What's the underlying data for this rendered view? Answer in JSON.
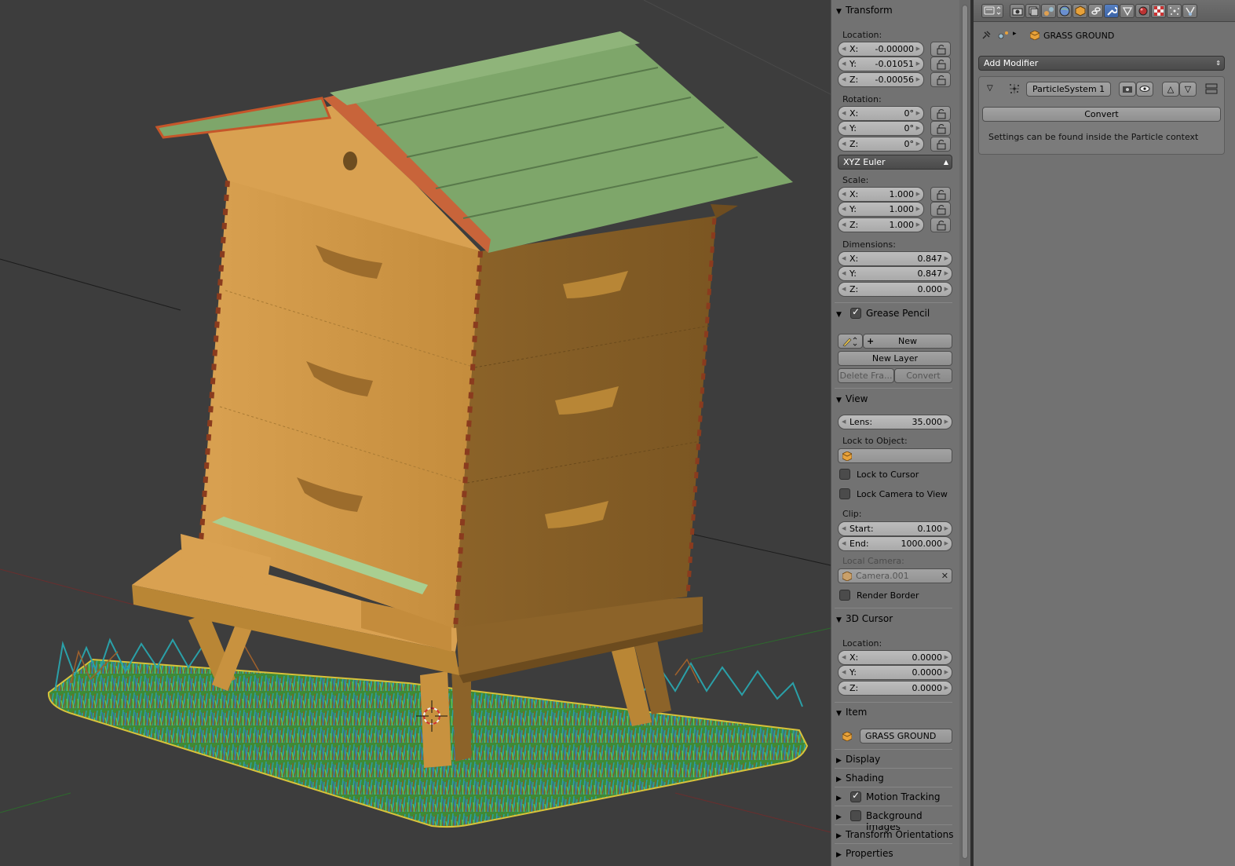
{
  "npanel": {
    "transform": {
      "title": "Transform",
      "location_label": "Location:",
      "location": [
        {
          "k": "X:",
          "v": "-0.00000"
        },
        {
          "k": "Y:",
          "v": "-0.01051"
        },
        {
          "k": "Z:",
          "v": "-0.00056"
        }
      ],
      "rotation_label": "Rotation:",
      "rotation": [
        {
          "k": "X:",
          "v": "0°"
        },
        {
          "k": "Y:",
          "v": "0°"
        },
        {
          "k": "Z:",
          "v": "0°"
        }
      ],
      "rotation_mode": "XYZ Euler",
      "scale_label": "Scale:",
      "scale": [
        {
          "k": "X:",
          "v": "1.000"
        },
        {
          "k": "Y:",
          "v": "1.000"
        },
        {
          "k": "Z:",
          "v": "1.000"
        }
      ],
      "dimensions_label": "Dimensions:",
      "dimensions": [
        {
          "k": "X:",
          "v": "0.847"
        },
        {
          "k": "Y:",
          "v": "0.847"
        },
        {
          "k": "Z:",
          "v": "0.000"
        }
      ]
    },
    "grease_pencil": {
      "title": "Grease Pencil",
      "enabled": true,
      "new_label": "New",
      "new_layer_label": "New Layer",
      "delete_frame_label": "Delete Fra...",
      "convert_label": "Convert"
    },
    "view": {
      "title": "View",
      "lens_key": "Lens:",
      "lens_value": "35.000",
      "lock_object_label": "Lock to Object:",
      "lock_cursor_label": "Lock to Cursor",
      "lock_camera_label": "Lock Camera to View",
      "clip_label": "Clip:",
      "clip_start_key": "Start:",
      "clip_start_value": "0.100",
      "clip_end_key": "End:",
      "clip_end_value": "1000.000",
      "local_camera_label": "Local Camera:",
      "local_camera_value": "Camera.001",
      "render_border_label": "Render Border"
    },
    "cursor": {
      "title": "3D Cursor",
      "location_label": "Location:",
      "location": [
        {
          "k": "X:",
          "v": "0.0000"
        },
        {
          "k": "Y:",
          "v": "0.0000"
        },
        {
          "k": "Z:",
          "v": "0.0000"
        }
      ]
    },
    "item": {
      "title": "Item",
      "name": "GRASS GROUND"
    },
    "collapsed": {
      "display": "Display",
      "shading": "Shading",
      "motion_tracking": "Motion Tracking",
      "background_images": "Background Images",
      "transform_orientations": "Transform Orientations",
      "properties": "Properties"
    }
  },
  "props": {
    "active_tab": "modifiers",
    "object_name": "GRASS GROUND",
    "add_modifier_label": "Add Modifier",
    "modifier_name": "ParticleSystem 1",
    "convert_label": "Convert",
    "info_text": "Settings can be found inside the Particle context"
  },
  "colors": {
    "panel_bg": "#727272",
    "viewport_bg": "#3d3d3d",
    "active_tab": "#5680c2",
    "hive_wood": "#c8923f",
    "roof_green": "#7ea66a"
  }
}
